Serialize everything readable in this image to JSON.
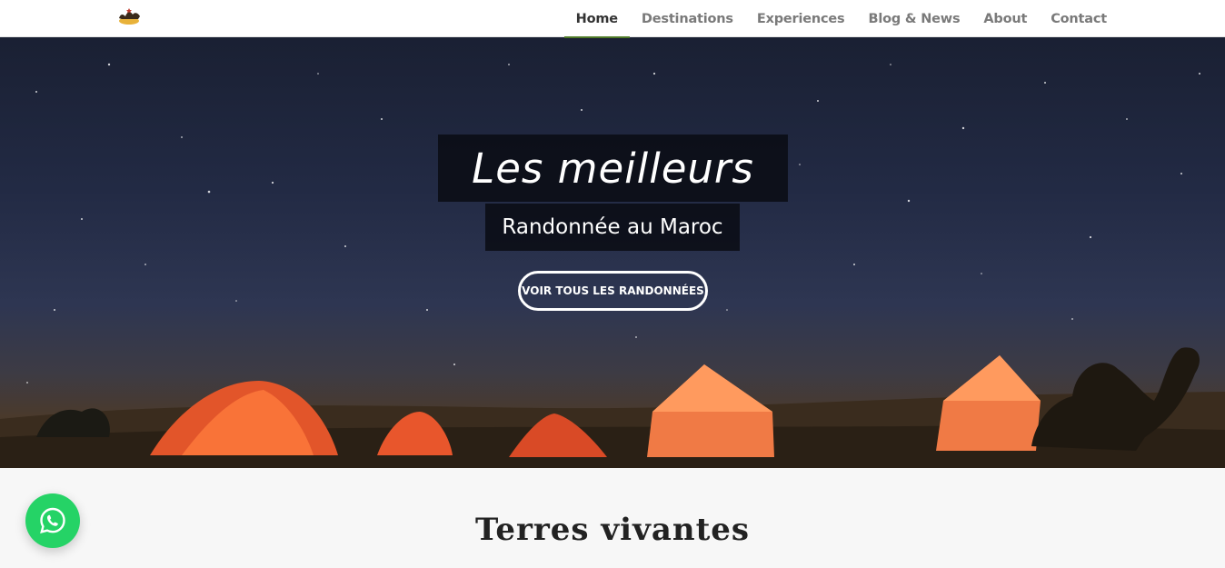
{
  "header": {
    "logo_icon": "camel-logo-icon",
    "nav": [
      {
        "label": "Home",
        "active": true
      },
      {
        "label": "Destinations",
        "active": false
      },
      {
        "label": "Experiences",
        "active": false
      },
      {
        "label": "Blog & News",
        "active": false
      },
      {
        "label": "About",
        "active": false
      },
      {
        "label": "Contact",
        "active": false
      }
    ],
    "active_color": "#4f7a28"
  },
  "hero": {
    "title": "Les meilleurs",
    "subtitle": "Randonnée au Maroc",
    "cta_label": "VOIR TOUS LES RANDONNÉES"
  },
  "section": {
    "title": "Terres vivantes"
  },
  "whatsapp": {
    "icon": "whatsapp-icon",
    "color": "#25d366"
  }
}
